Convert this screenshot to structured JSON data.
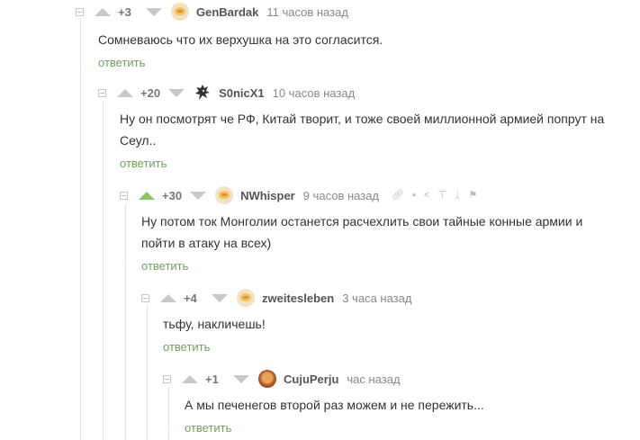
{
  "comments": [
    {
      "rating": "+3",
      "author": "GenBardak",
      "time": "11 часов назад",
      "text": "Сомневаюсь что их верхушка на это согласится.",
      "reply": "ответить",
      "avatar_icon": "pikachu-avatar-icon",
      "vote_state": "neutral"
    },
    {
      "rating": "+20",
      "author": "S0nicX1",
      "time": "10 часов назад",
      "text": "Ну он посмотрят че РФ, Китай творит, и тоже своей миллионной армией попрут на Сеул..",
      "reply": "ответить",
      "avatar_icon": "dragon-avatar-icon",
      "vote_state": "neutral"
    },
    {
      "rating": "+30",
      "author": "NWhisper",
      "time": "9 часов назад",
      "text": "Ну потом ток Монголии останется расчехлить свои тайные конные армии и пойти в атаку на всех)",
      "reply": "ответить",
      "avatar_icon": "pikachu-avatar-icon",
      "vote_state": "upvoted"
    },
    {
      "rating": "+4",
      "author": "zweitesleben",
      "time": "3 часа назад",
      "text": "тьфу, накличешь!",
      "reply": "ответить",
      "avatar_icon": "pikachu-avatar-icon",
      "vote_state": "neutral"
    },
    {
      "rating": "+1",
      "author": "CujuPerju",
      "time": "час назад",
      "text": "А мы печенегов второй раз можем и не пережить...",
      "reply": "ответить",
      "avatar_icon": "cuju-avatar-icon",
      "vote_state": "neutral"
    }
  ],
  "colors": {
    "accent_green": "#8ac858",
    "reply_link": "#6aa84f",
    "vote_gray": "#c8c8c8"
  }
}
